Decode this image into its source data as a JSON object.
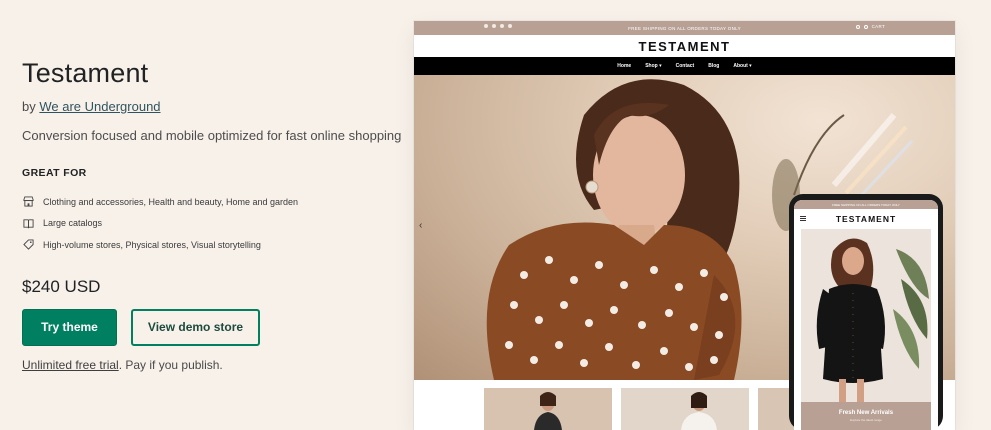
{
  "theme": {
    "title": "Testament",
    "by_prefix": "by",
    "developer": "We are Underground",
    "tagline": "Conversion focused and mobile optimized for fast online shopping",
    "great_for_heading": "GREAT FOR",
    "features": [
      {
        "icon": "store-icon",
        "text": "Clothing and accessories, Health and beauty, Home and garden"
      },
      {
        "icon": "book-icon",
        "text": "Large catalogs"
      },
      {
        "icon": "tag-icon",
        "text": "High-volume stores, Physical stores, Visual storytelling"
      }
    ],
    "price": "$240 USD",
    "try_label": "Try theme",
    "demo_label": "View demo store",
    "trial_link": "Unlimited free trial",
    "trial_suffix": ". Pay if you publish."
  },
  "preview": {
    "announcement": "FREE SHIPPING ON ALL ORDERS TODAY ONLY",
    "header_right": "CART",
    "logo": "TESTAMENT",
    "nav": [
      "Home",
      "Shop ▾",
      "Contact",
      "Blog",
      "About ▾"
    ],
    "hero_arrow": "‹"
  },
  "phone": {
    "announcement": "FREE SHIPPING ON ALL ORDERS TODAY ONLY",
    "logo": "TESTAMENT",
    "banner_title": "Fresh New Arrivals",
    "banner_sub": "Explore the latest range"
  },
  "colors": {
    "page_bg": "#f8f1ea",
    "primary_green": "#008060",
    "announcement_tan": "#b8a095",
    "nav_black": "#000000"
  }
}
